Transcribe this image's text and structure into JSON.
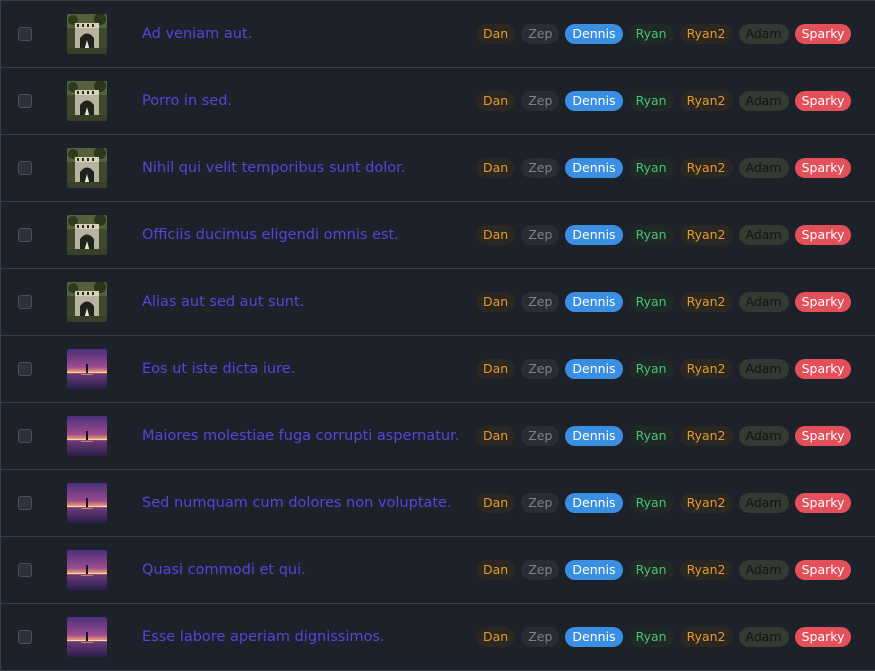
{
  "rows": [
    {
      "title": "Ad veniam aut.",
      "image": "castle-gate-image"
    },
    {
      "title": "Porro in sed.",
      "image": "castle-gate-image"
    },
    {
      "title": "Nihil qui velit temporibus sunt dolor.",
      "image": "castle-gate-image"
    },
    {
      "title": "Officiis ducimus eligendi omnis est.",
      "image": "castle-gate-image"
    },
    {
      "title": "Alias aut sed aut sunt.",
      "image": "castle-gate-image"
    },
    {
      "title": "Eos ut iste dicta iure.",
      "image": "sunset-lake-image"
    },
    {
      "title": "Maiores molestiae fuga corrupti aspernatur.",
      "image": "sunset-lake-image"
    },
    {
      "title": "Sed numquam cum dolores non voluptate.",
      "image": "sunset-lake-image"
    },
    {
      "title": "Quasi commodi et qui.",
      "image": "sunset-lake-image"
    },
    {
      "title": "Esse labore aperiam dignissimos.",
      "image": "sunset-lake-image"
    }
  ],
  "badges": [
    {
      "label": "Dan",
      "cls": "b-dan",
      "color": "#e39a2c"
    },
    {
      "label": "Zep",
      "cls": "b-zep",
      "color": "#7c818c"
    },
    {
      "label": "Dennis",
      "cls": "b-dennis",
      "color": "#3a8fe2"
    },
    {
      "label": "Ryan",
      "cls": "b-ryan",
      "color": "#4bbf76"
    },
    {
      "label": "Ryan2",
      "cls": "b-ryan2",
      "color": "#e39a2c"
    },
    {
      "label": "Adam",
      "cls": "b-adam",
      "color": "#323a31"
    },
    {
      "label": "Sparky",
      "cls": "b-sparky",
      "color": "#e4505a"
    }
  ],
  "colors": {
    "background": "#1d212a",
    "row_border": "#363c48",
    "title_link": "#5048d8"
  }
}
